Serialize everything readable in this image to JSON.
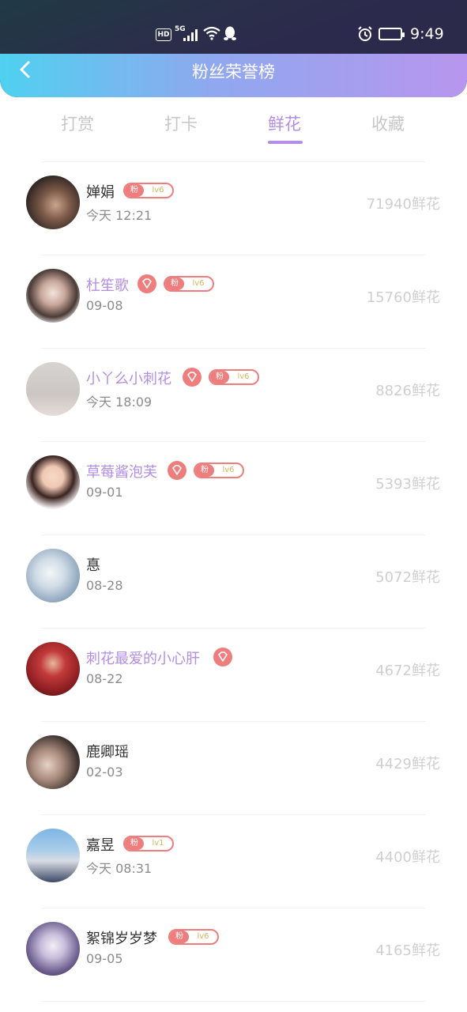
{
  "status_bar": {
    "hd": "HD",
    "network": "5G",
    "time": "9:49",
    "icons": [
      "signal-icon",
      "wifi-icon",
      "qq-icon",
      "alarm-icon",
      "battery-icon"
    ]
  },
  "header": {
    "title": "粉丝荣誉榜",
    "back_icon": "chevron-left-icon"
  },
  "tabs": [
    {
      "label": "打赏",
      "active": false
    },
    {
      "label": "打卡",
      "active": false
    },
    {
      "label": "鲜花",
      "active": true
    },
    {
      "label": "收藏",
      "active": false
    }
  ],
  "ranking": [
    {
      "name": "婵娟",
      "vip": false,
      "diamond": false,
      "fan_badge": "粉",
      "level": "lv6",
      "date": "今天 12:21",
      "amount": "71940鲜花"
    },
    {
      "name": "杜笙歌",
      "vip": true,
      "diamond": true,
      "fan_badge": "粉",
      "level": "lv6",
      "date": "09-08",
      "amount": "15760鲜花"
    },
    {
      "name": "小丫么小刺花",
      "vip": true,
      "diamond": true,
      "fan_badge": "粉",
      "level": "lv6",
      "date": "今天 18:09",
      "amount": "8826鲜花"
    },
    {
      "name": "草莓酱泡芙",
      "vip": true,
      "diamond": true,
      "fan_badge": "粉",
      "level": "lv6",
      "date": "09-01",
      "amount": "5393鲜花"
    },
    {
      "name": "惪",
      "vip": false,
      "diamond": false,
      "fan_badge": "",
      "level": "",
      "date": "08-28",
      "amount": "5072鲜花"
    },
    {
      "name": "刺花最爱的小心肝",
      "vip": true,
      "diamond": true,
      "fan_badge": "",
      "level": "",
      "date": "08-22",
      "amount": "4672鲜花"
    },
    {
      "name": "鹿卿瑶",
      "vip": false,
      "diamond": false,
      "fan_badge": "",
      "level": "",
      "date": "02-03",
      "amount": "4429鲜花"
    },
    {
      "name": "嘉昱",
      "vip": false,
      "diamond": false,
      "fan_badge": "粉",
      "level": "lv1",
      "date": "今天 08:31",
      "amount": "4400鲜花"
    },
    {
      "name": "絮锦岁岁梦",
      "vip": false,
      "diamond": false,
      "fan_badge": "粉",
      "level": "lv6",
      "date": "09-05",
      "amount": "4165鲜花"
    }
  ],
  "colors": {
    "accent": "#b48de4",
    "badge": "#ee7d7d",
    "amount": "#cfcfcf"
  }
}
